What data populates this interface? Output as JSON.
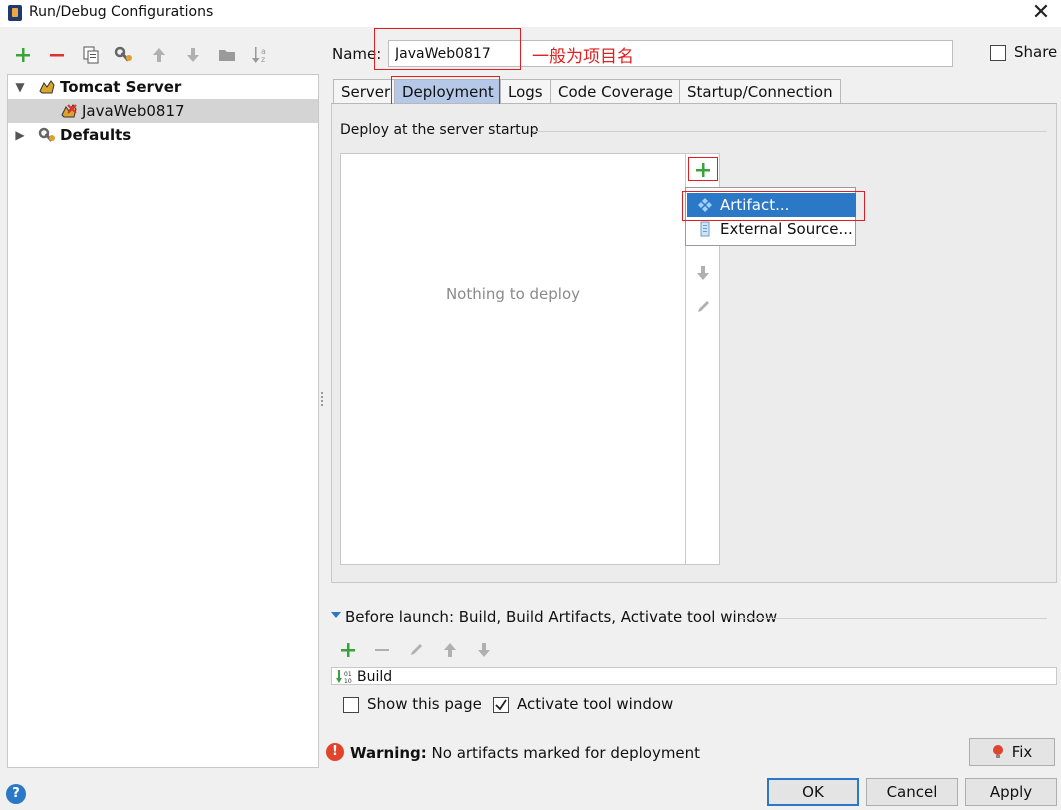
{
  "window": {
    "title": "Run/Debug Configurations",
    "close_glyph": "✕"
  },
  "left_toolbar": {
    "icons": [
      "add-icon",
      "remove-icon",
      "copy-icon",
      "edit-defaults-icon",
      "move-up-icon",
      "move-down-icon",
      "folder-icon",
      "sort-icon"
    ]
  },
  "tree": {
    "items": [
      {
        "label": "Tomcat Server",
        "expanded": true,
        "bold": true,
        "icon": "tomcat-icon"
      },
      {
        "label": "JavaWeb0817",
        "selected": true,
        "icon": "tomcat-config-icon"
      },
      {
        "label": "Defaults",
        "expanded": false,
        "bold": true,
        "icon": "wrench-icon"
      }
    ]
  },
  "name_field": {
    "label": "Name:",
    "value": "JavaWeb0817"
  },
  "annotation": "一般为项目名",
  "share": {
    "label": "Share",
    "checked": false
  },
  "tabs": [
    {
      "label": "Server"
    },
    {
      "label": "Deployment",
      "active": true
    },
    {
      "label": "Logs"
    },
    {
      "label": "Code Coverage"
    },
    {
      "label": "Startup/Connection"
    }
  ],
  "deployment": {
    "group_label": "Deploy at the server startup",
    "empty_text": "Nothing to deploy"
  },
  "popup_menu": {
    "items": [
      {
        "label": "Artifact...",
        "selected": true,
        "icon": "artifact-icon"
      },
      {
        "label": "External Source...",
        "icon": "external-source-icon"
      }
    ]
  },
  "before_launch": {
    "label": "Before launch: Build, Build Artifacts, Activate tool window",
    "items": [
      "Build"
    ]
  },
  "show_this_page": {
    "label": "Show this page",
    "checked": false
  },
  "activate_tool_window": {
    "label": "Activate tool window",
    "checked": true
  },
  "warning": {
    "title": "Warning:",
    "message": " No artifacts marked for deployment"
  },
  "buttons": {
    "fix": "Fix",
    "ok": "OK",
    "cancel": "Cancel",
    "apply": "Apply"
  },
  "colors": {
    "accent": "#2b78c6",
    "annotation_red": "#e02020",
    "add_green": "#3aa23a",
    "remove_red": "#e03030",
    "active_tab": "#b5c8e8"
  }
}
